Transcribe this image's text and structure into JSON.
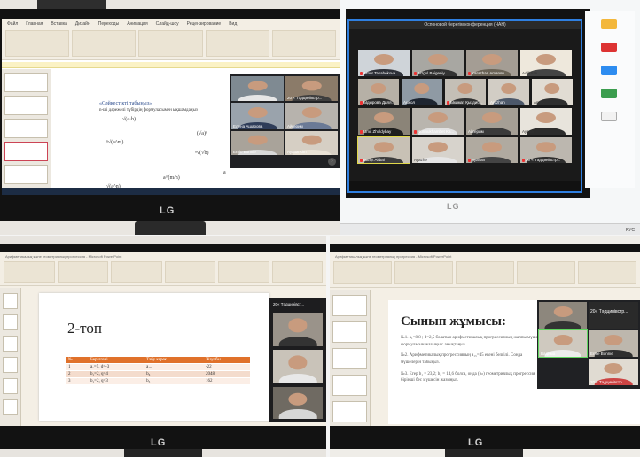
{
  "panel_top_left": {
    "monitor_brand": "LG",
    "ribbon_tabs": [
      "Файл",
      "Главная",
      "Вставка",
      "Дизайн",
      "Переходы",
      "Анимация",
      "Слайд-шоу",
      "Рецензирование",
      "Вид"
    ],
    "slide_title": "«Сәйкестікті табыңыз»",
    "slide_task": "n-ші дәрежелі түбірдің формуласымен ықшамдаңыз",
    "math_items": [
      "√(a·b)",
      "ⁿ√(a^m)",
      "(√a)ⁿ",
      "ⁿ√(√b)",
      "√(a^n)",
      "a^(m/n)",
      "a"
    ],
    "meeting_names": [
      "",
      "20 « Тәдцинівстр...",
      "Елена Ашарова",
      "Айгерим",
      "Ernie Bonnie",
      "Ayana Kim"
    ],
    "meeting_next": "›"
  },
  "panel_top_right": {
    "window_title": "Оспоновой берегім конференция (ЧАН)",
    "participants": [
      "Arnur Tasabekova",
      "Aizgul Baigeniy",
      "Karazhan Amansu...",
      "Adilkhan...",
      "Ыдырова Диля...",
      "Акжол",
      "Ыкимат Қыздиб...",
      "Aruzhan",
      "Aruzhan",
      "Aminy",
      "Umit Zholdybay",
      "Nurmukhambet Ka...",
      "Айгерим",
      "Ayana",
      "Banyt Aitbai",
      "Ayazhe",
      "Ayanan",
      "20 « Тәдцинівстр..."
    ],
    "tray_text": "РУС"
  },
  "panel_bottom_left": {
    "monitor_brand": "LG",
    "window_title": "Арифметикалық және геометриялық прогрессия - Microsoft PowerPoint",
    "slide_title": "2-топ",
    "table_headers": [
      "№",
      "Берілгені",
      "Табу керек",
      "Жауабы"
    ],
    "table_rows": [
      [
        "1",
        "a₁=5, d=-3",
        "a₁₀",
        "-22"
      ],
      [
        "2",
        "b₁=2, q=4",
        "b₆",
        "2048"
      ],
      [
        "3",
        "b₁=2, q=3",
        "b₅",
        "162"
      ]
    ],
    "meeting_name": "20« Тәдцинівст..."
  },
  "panel_bottom_right": {
    "monitor_brand": "LG",
    "window_title": "Арифметикалық және геометриялық прогрессия - Microsoft PowerPoint",
    "slide_title": "Сынып жұмысы:",
    "text_lines": [
      "№1. a₁=8,8 ; d=2,5 болатын арифметикалық прогрессияның жалпы мүшесінің",
      "формуласын жазыңыз: анықтаңыз.",
      "№2. Арифметикалық прогрессияның а₁₅=45 екені белгілі. Сонда",
      "мүшелерін табыңыз.",
      "№3. Егер b₁ = 23,2; b₂ = 14,6 болса, онда (bₙ) геометриялық прогрессия",
      "бірінші бес мүшесін жазыңыз."
    ],
    "meeting_names": [
      "20« Тәдцинівстр...",
      "Вадима",
      "Ernie Bonnie",
      "20 « Тәдцинівстр"
    ]
  }
}
